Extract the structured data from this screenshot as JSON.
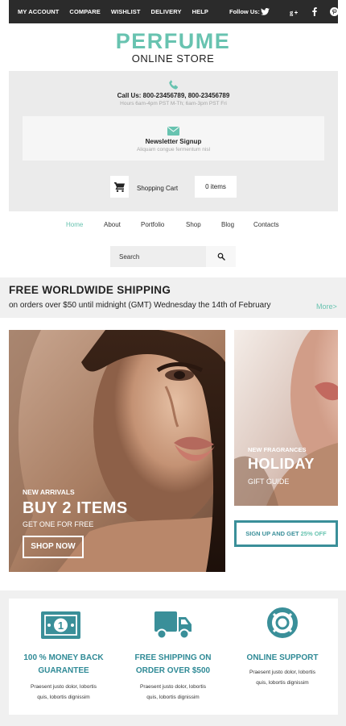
{
  "topbar": {
    "nav": [
      "MY ACCOUNT",
      "COMPARE",
      "WISHLIST",
      "DELIVERY",
      "HELP"
    ],
    "follow_label": "Follow Us:",
    "social_icons": [
      "twitter-icon",
      "google-plus-icon",
      "facebook-icon",
      "pinterest-icon"
    ]
  },
  "logo": {
    "title": "PERFUME",
    "subtitle": "ONLINE STORE",
    "color": "#68c3b0"
  },
  "contact": {
    "call": "Call Us: 800-23456789, 800-23456789",
    "hours": "Hours 6am-4pm PST M-Th; 6am-3pm PST Fri"
  },
  "newsletter": {
    "title": "Newsletter Signup",
    "subtitle": "Aliquam congue fermentum nisl"
  },
  "cart": {
    "label": "Shopping Cart",
    "items": "0 items"
  },
  "main_nav": [
    "Home",
    "About",
    "Portfolio",
    "Shop",
    "Blog",
    "Contacts"
  ],
  "search": {
    "placeholder": "Search"
  },
  "shipping": {
    "title": "FREE WORLDWIDE SHIPPING",
    "subtitle": "on orders over $50 until midnight (GMT) Wednesday  the 14th of February",
    "more": "More>"
  },
  "hero_main": {
    "eyebrow": "NEW ARRIVALS",
    "headline": "BUY 2 ITEMS",
    "sub": "GET ONE FOR FREE",
    "button": "SHOP NOW"
  },
  "hero_side": {
    "eyebrow": "NEW FRAGRANCES",
    "headline": "HOLIDAY",
    "sub": "GIFT GUIDE"
  },
  "signup_promo": {
    "prefix": "SIGN UP AND GET",
    "highlight": "25% OFF"
  },
  "features": [
    {
      "icon": "money-icon",
      "title_line1": "100 % MONEY BACK",
      "title_line2": "GUARANTEE",
      "text_line1": "Praesent justo dolor, lobortis",
      "text_line2": "quis, lobortis dignissim"
    },
    {
      "icon": "truck-icon",
      "title_line1": "FREE SHIPPING ON",
      "title_line2": "ORDER OVER $500",
      "text_line1": "Praesent justo dolor, lobortis",
      "text_line2": "quis, lobortis dignissim"
    },
    {
      "icon": "lifebuoy-icon",
      "title_line1": "ONLINE SUPPORT",
      "title_line2": "",
      "text_line1": "Praesent justo dolor, lobortis",
      "text_line2": "quis, lobortis dignissim"
    }
  ],
  "colors": {
    "accent": "#68c3b0",
    "teal": "#2f8a96",
    "dark": "#2b2b2b"
  }
}
